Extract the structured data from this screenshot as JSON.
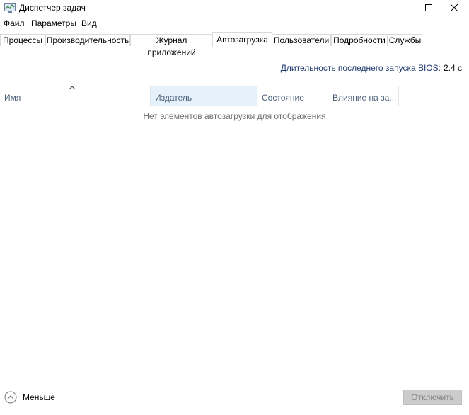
{
  "window": {
    "title": "Диспетчер задач",
    "icon": "task-manager-icon"
  },
  "menu": [
    "Файл",
    "Параметры",
    "Вид"
  ],
  "tabs": [
    "Процессы",
    "Производительность",
    "Журнал приложений",
    "Автозагрузка",
    "Пользователи",
    "Подробности",
    "Службы"
  ],
  "active_tab": "Автозагрузка",
  "bios": {
    "label": "Длительность последнего запуска BIOS:",
    "value": "2.4 с"
  },
  "columns": [
    "Имя",
    "Издатель",
    "Состояние",
    "Влияние на за..."
  ],
  "sorted_column": "Издатель",
  "empty_message": "Нет элементов автозагрузки для отображения",
  "footer": {
    "less_label": "Меньше",
    "disable_label": "Отключить",
    "disable_enabled": false
  }
}
